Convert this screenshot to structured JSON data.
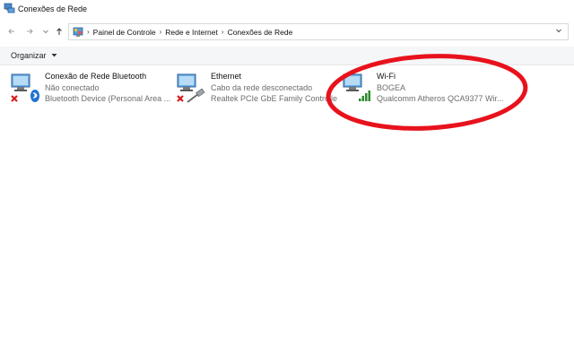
{
  "window": {
    "title": "Conexões de Rede"
  },
  "nav": {
    "back_icon": "arrow-left-icon",
    "forward_icon": "arrow-right-icon",
    "dropdown_icon": "chevron-down-icon",
    "up_icon": "arrow-up-icon"
  },
  "address_bar": {
    "crumbs": [
      "Painel de Controle",
      "Rede e Internet",
      "Conexões de Rede"
    ]
  },
  "command_bar": {
    "organize_label": "Organizar"
  },
  "connections": [
    {
      "name": "Conexão de Rede Bluetooth",
      "status": "Não conectado",
      "device": "Bluetooth Device (Personal Area ..."
    },
    {
      "name": "Ethernet",
      "status": "Cabo da rede desconectado",
      "device": "Realtek PCIe GbE Family Controlle"
    },
    {
      "name": "Wi-Fi",
      "status": "BOGEA",
      "device": "Qualcomm Atheros QCA9377 Wir..."
    }
  ],
  "annotation": {
    "color": "#e8121c"
  }
}
